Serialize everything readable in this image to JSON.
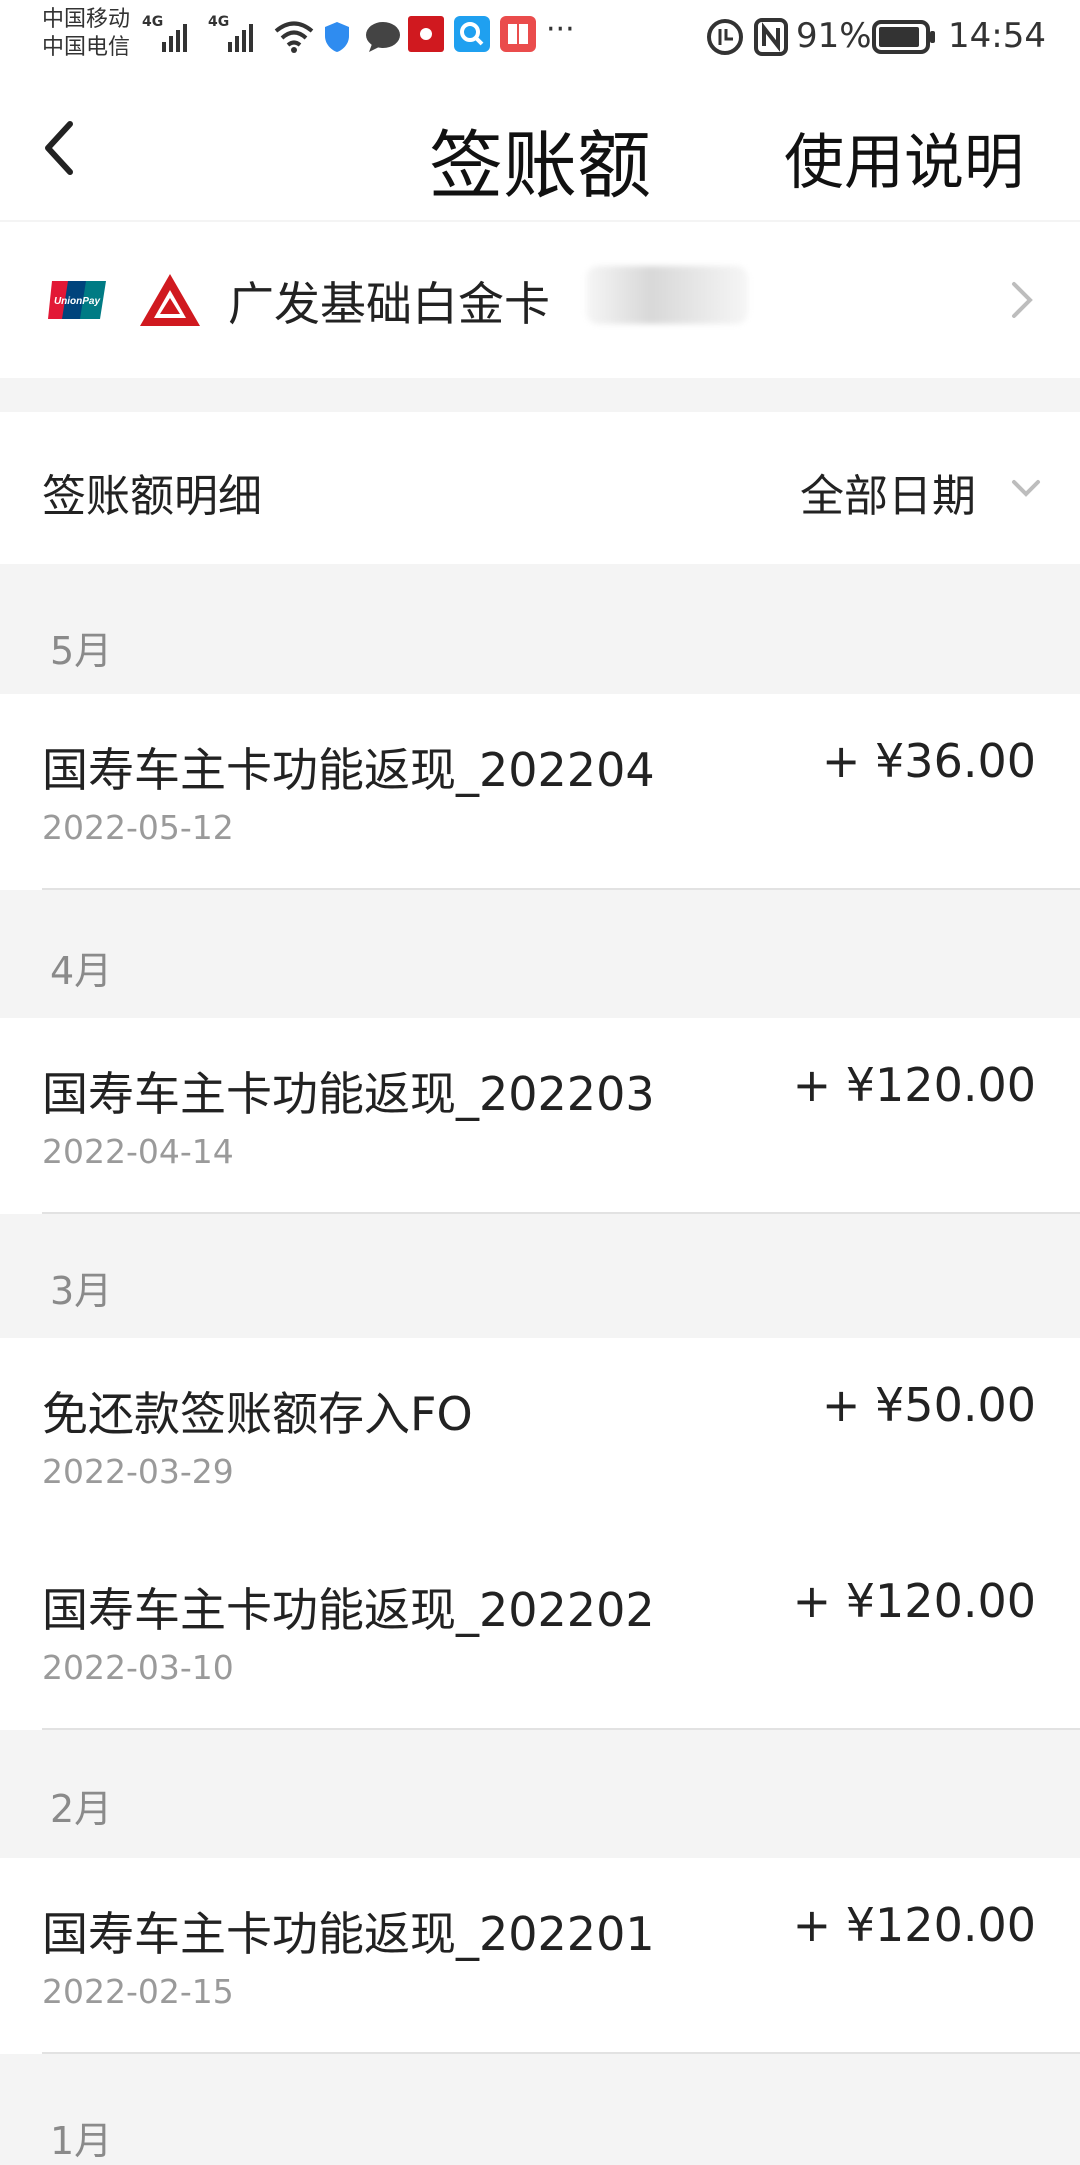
{
  "status": {
    "carrier1": "中国移动",
    "carrier2": "中国电信",
    "network": "4G",
    "battery": "91%",
    "time": "14:54",
    "more": "···"
  },
  "header": {
    "title": "签账额",
    "help_label": "使用说明"
  },
  "card": {
    "name": "广发基础白金卡",
    "unionpay_text": "UnionPay"
  },
  "filter": {
    "label": "签账额明细",
    "value": "全部日期"
  },
  "months": [
    {
      "label": "5月"
    },
    {
      "label": "4月"
    },
    {
      "label": "3月"
    },
    {
      "label": "2月"
    },
    {
      "label": "1月"
    }
  ],
  "transactions": [
    {
      "title": "国寿车主卡功能返现_202204",
      "date": "2022-05-12",
      "amount": "+ ¥36.00"
    },
    {
      "title": "国寿车主卡功能返现_202203",
      "date": "2022-04-14",
      "amount": "+ ¥120.00"
    },
    {
      "title": "免还款签账额存入FO",
      "date": "2022-03-29",
      "amount": "+ ¥50.00"
    },
    {
      "title": "国寿车主卡功能返现_202202",
      "date": "2022-03-10",
      "amount": "+ ¥120.00"
    },
    {
      "title": "国寿车主卡功能返现_202201",
      "date": "2022-02-15",
      "amount": "+ ¥120.00"
    }
  ],
  "colors": {
    "brand_red": "#d0191f",
    "muted_text": "#9a9a9a",
    "background": "#f4f4f4"
  },
  "icons": [
    "back-arrow-icon",
    "unionpay-logo",
    "cgb-bank-logo",
    "chevron-right-icon",
    "chevron-down-icon",
    "wifi-icon",
    "nfc-icon",
    "battery-icon"
  ]
}
